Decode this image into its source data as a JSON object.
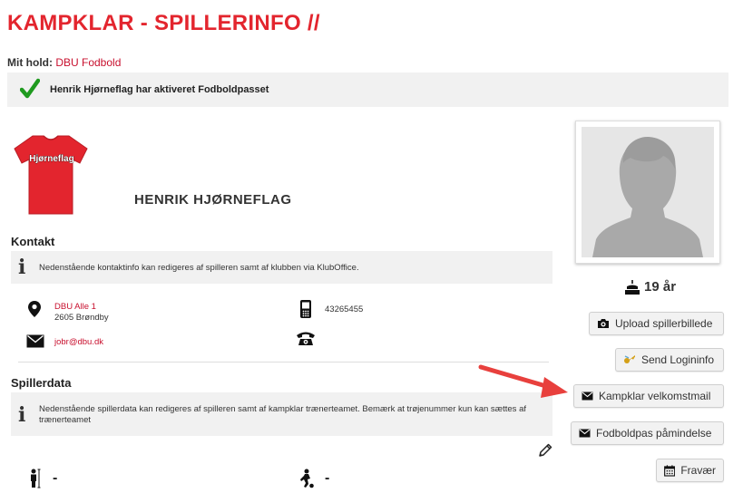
{
  "page": {
    "title": "KAMPKLAR - SPILLERINFO //",
    "team_label": "Mit hold:",
    "team_name": "DBU Fodbold"
  },
  "banner": {
    "text": "Henrik Hjørneflag har aktiveret Fodboldpasset",
    "icon": "checkmark-icon",
    "color": "#1f9a1f"
  },
  "player": {
    "shirt_text": "Hjørneflag",
    "shirt_color": "#e3252e",
    "name": "HENRIK HJØRNEFLAG",
    "age": "19 år"
  },
  "contact": {
    "heading": "Kontakt",
    "info": "Nedenstående kontaktinfo kan redigeres af spilleren samt af klubben via KlubOffice.",
    "address_line1": "DBU Alle 1",
    "address_line2": "2605 Brøndby",
    "phone": "43265455",
    "email": "jobr@dbu.dk"
  },
  "spillerdata": {
    "heading": "Spillerdata",
    "info": "Nedenstående spillerdata kan redigeres af spilleren samt af kampklar trænerteamet. Bemærk at trøjenummer kun kan sættes af trænerteamet",
    "field1_value": "-",
    "field2_value": "-"
  },
  "buttons": {
    "upload": "Upload spillerbillede",
    "send_login": "Send Logininfo",
    "welcome_mail": "Kampklar velkomstmail",
    "reminder": "Fodboldpas påmindelse",
    "absence": "Fravær"
  },
  "colors": {
    "brand_red": "#e3252e",
    "arrow_red": "#e8403d"
  }
}
